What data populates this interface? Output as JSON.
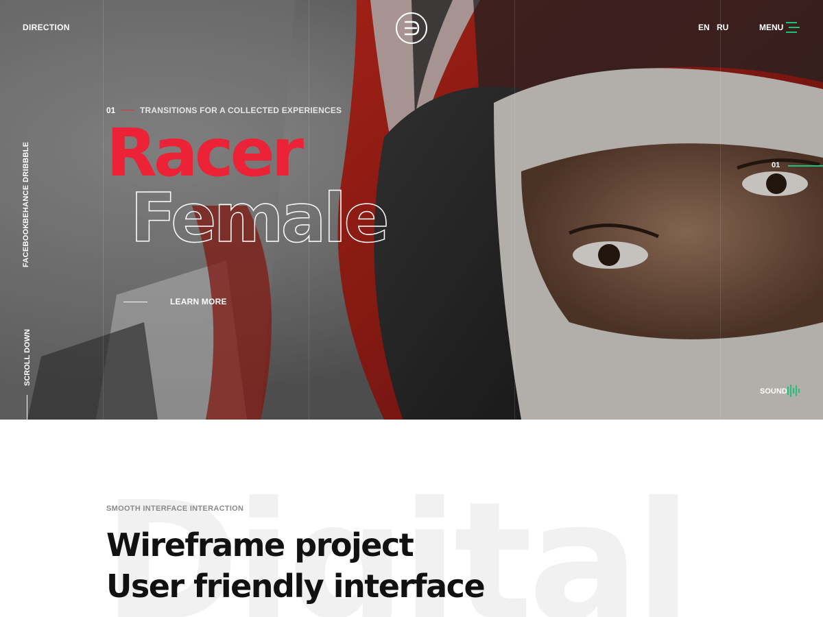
{
  "header": {
    "brand": "DIRECTION",
    "logo_icon": "d-letter-logo-icon",
    "languages": [
      "EN",
      "RU"
    ],
    "menu_label": "MENU"
  },
  "social": [
    "DRIBBBLE",
    "BEHANCE",
    "FACEBOOK"
  ],
  "scroll_label": "SCROLL DOWN",
  "hero": {
    "slide_number": "01",
    "subtitle": "TRANSITIONS FOR A COLLECTED EXPERIENCES",
    "title_primary": "Racer",
    "title_outline": "Female",
    "cta_label": "LEARN MORE",
    "side_slide_number": "01",
    "sound_label": "SOUND"
  },
  "section": {
    "background_word": "Digital",
    "kicker": "SMOOTH INTERFACE INTERACTION",
    "heading_line1": "Wireframe project",
    "heading_line2": "User friendly interface"
  },
  "colors": {
    "accent_red": "#ec2336",
    "accent_green": "#1fc27a",
    "text_dark": "#111111"
  }
}
